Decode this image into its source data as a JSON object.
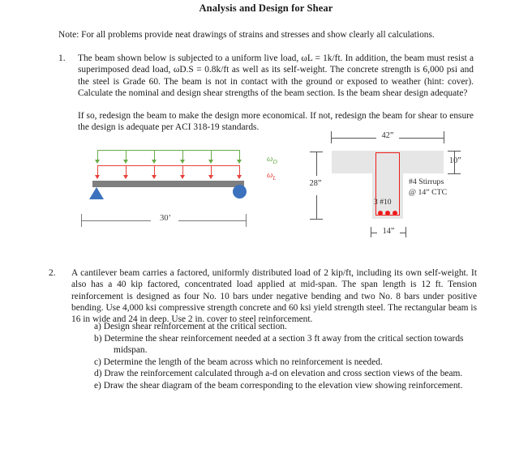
{
  "document": {
    "title": "Analysis and Design for Shear",
    "note": "Note: For all problems provide neat drawings of strains and stresses and show clearly all calculations."
  },
  "problems": [
    {
      "number": "1.",
      "text": "The beam shown below is subjected to a uniform live load, ωL = 1k/ft. In addition, the beam must resist a superimposed dead load, ωD.S = 0.8k/ft as well as its self-weight. The concrete strength is 6,000 psi and the steel is Grade 60. The beam is not in contact with the ground or exposed to weather (hint: cover). Calculate the nominal and design shear strengths of the beam section. Is the beam shear design adequate?",
      "text2": "If so, redesign the beam to make the design more economical. If not, redesign the beam for shear to ensure the design is adequate per ACI 318-19 standards."
    },
    {
      "number": "2.",
      "text": "A cantilever beam carries a factored, uniformly distributed load of 2 kip/ft, including its own self-weight. It also has a 40 kip factored, concentrated load applied at mid-span. The span length is 12 ft. Tension reinforcement is designed as four No. 10 bars under negative bending and two No. 8 bars under positive bending. Use 4,000 ksi compressive strength concrete and 60 ksi yield strength steel. The rectangular beam is 16 in wide and 24 in deep. Use 2 in. cover to steel reinforcement.",
      "subitems": [
        {
          "label": "a)",
          "text": "Design shear reinforcement at the critical section.",
          "cont": ""
        },
        {
          "label": "b)",
          "text": "Determine the shear reinforcement needed at a section 3 ft away from the critical section towards",
          "cont": "midspan."
        },
        {
          "label": "c)",
          "text": "Determine the length of the beam across which no reinforcement is needed.",
          "cont": ""
        },
        {
          "label": "d)",
          "text": "Draw the reinforcement calculated through a-d on elevation and cross section views of the beam.",
          "cont": ""
        },
        {
          "label": "e)",
          "text": "Draw the shear diagram of the beam corresponding to the elevation view showing reinforcement.",
          "cont": ""
        }
      ]
    }
  ],
  "figures": {
    "beam_elevation": {
      "span_label": "30’",
      "dead_load_label": "ω",
      "dead_load_sub": "D",
      "live_load_label": "ω",
      "live_load_sub": "L",
      "dead_load_color": "#6aaa48",
      "live_load_color": "#e8413a",
      "beam_color": "#7f7f7f",
      "support_color": "#3c72bd",
      "arrow_count": 6
    },
    "cross_section": {
      "flange_width_label": "42”",
      "flange_depth_label": "10”",
      "total_depth_label": "28”",
      "web_width_label": "14”",
      "rebar_label": "3 #10",
      "stirrup_label_line1": "#4 Stirrups",
      "stirrup_label_line2": "@ 14” CTC",
      "concrete_color": "#e6e6e6",
      "steel_color": "#ee1c1c",
      "rebar_count": 3
    }
  }
}
